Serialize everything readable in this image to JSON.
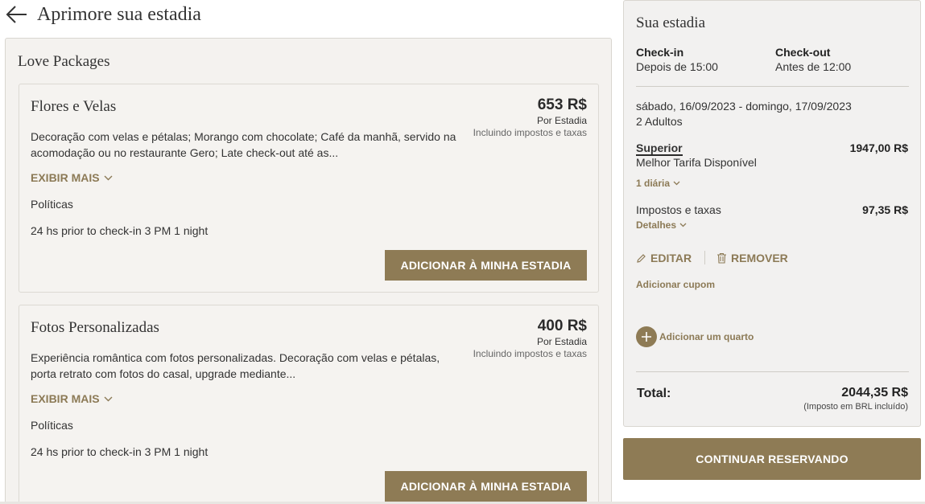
{
  "header": {
    "title": "Aprimore sua estadia",
    "back_icon": "arrow-left-icon"
  },
  "main": {
    "section_title": "Love Packages",
    "packages": [
      {
        "title": "Flores e Velas",
        "price": "653 R$",
        "per": "Por Estadia",
        "tax_note": "Incluindo impostos e taxas",
        "description": "Decoração com velas e pétalas; Morango com chocolate; Café da manhã, servido na acomodação ou no restaurante Gero; Late check-out até as...",
        "show_more": "EXIBIR MAIS",
        "policies_label": "Políticas",
        "policy_text": "24 hs prior to check-in 3 PM 1 night",
        "add_button": "ADICIONAR À MINHA ESTADIA"
      },
      {
        "title": "Fotos Personalizadas",
        "price": "400 R$",
        "per": "Por Estadia",
        "tax_note": "Incluindo impostos e taxas",
        "description": "Experiência romântica com fotos personalizadas. Decoração com velas e pétalas, porta retrato com fotos do casal, upgrade mediante...",
        "show_more": "EXIBIR MAIS",
        "policies_label": "Políticas",
        "policy_text": "24 hs prior to check-in 3 PM 1 night",
        "add_button": "ADICIONAR À MINHA ESTADIA"
      }
    ]
  },
  "summary": {
    "title": "Sua estadia",
    "checkin_label": "Check-in",
    "checkin_value": "Depois de 15:00",
    "checkout_label": "Check-out",
    "checkout_value": "Antes de 12:00",
    "dates": "sábado, 16/09/2023 - domingo, 17/09/2023",
    "guests": "2 Adultos",
    "room_name": "Superior",
    "room_price": "1947,00 R$",
    "rate_name": "Melhor Tarifa Disponível",
    "nights": "1 diária",
    "taxes_label": "Impostos e taxas",
    "taxes_value": "97,35 R$",
    "details_label": "Detalhes",
    "edit_label": "EDITAR",
    "remove_label": "REMOVER",
    "coupon_label": "Adicionar cupom",
    "add_room_label": "Adicionar um quarto",
    "total_label": "Total:",
    "total_value": "2044,35 R$",
    "total_note": "(Imposto em BRL incluído)"
  },
  "continue_button": "CONTINUAR RESERVANDO",
  "colors": {
    "accent": "#8e7b55",
    "accent_text": "#8c7a56",
    "panel_bg": "#f4f2ef"
  }
}
